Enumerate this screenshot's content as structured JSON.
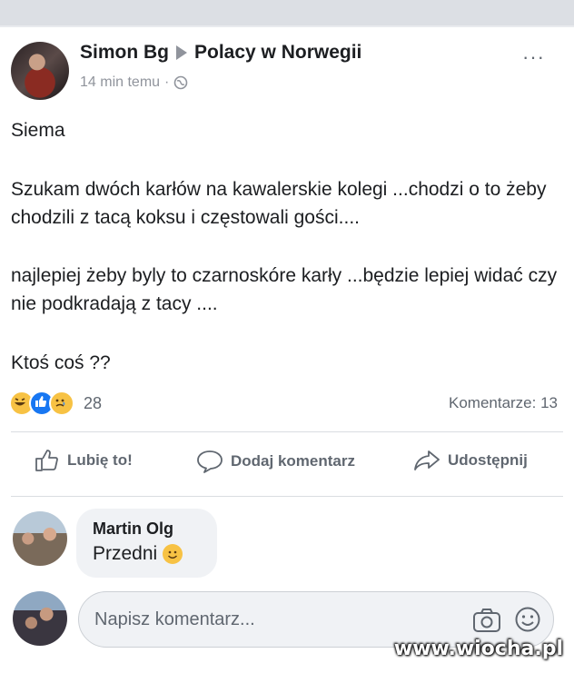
{
  "post": {
    "author": "Simon Bg",
    "group": "Polacy w Norwegii",
    "time": "14 min temu",
    "time_separator": "·",
    "more": "···",
    "paragraphs": [
      "Siema",
      "Szukam dwóch karłów na kawalerskie kolegi ...chodzi o to żeby chodzili z tacą koksu i częstowali gości....",
      "najlepiej żeby byly to czarnoskóre karły ...będzie lepiej widać czy nie podkradają z tacy ....",
      "Ktoś coś ??"
    ],
    "reactions_count": "28",
    "comments_count": "Komentarze: 13"
  },
  "actions": {
    "like": "Lubię to!",
    "comment": "Dodaj komentarz",
    "share": "Udostępnij"
  },
  "comment": {
    "author": "Martin Olg",
    "text": "Przedni"
  },
  "composer": {
    "placeholder": "Napisz komentarz..."
  },
  "watermark": "www.wiocha.pl",
  "colors": {
    "like_blue": "#1877f2",
    "emoji_yellow": "#f7c244",
    "muted_text": "#606770"
  }
}
